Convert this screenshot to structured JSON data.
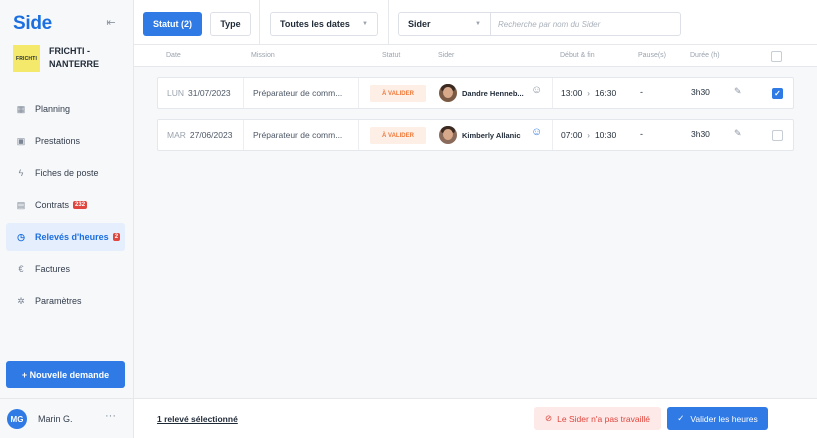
{
  "sidebar": {
    "brand": "Side",
    "collapse_icon": "collapse-sidebar-icon",
    "org": {
      "logo_text": "FRICHTI",
      "name": "FRICHTI - NANTERRE"
    },
    "items": [
      {
        "label": "Planning",
        "icon": "calendar-icon",
        "badge": ""
      },
      {
        "label": "Prestations",
        "icon": "briefcase-icon",
        "badge": ""
      },
      {
        "label": "Fiches de poste",
        "icon": "bolt-icon",
        "badge": ""
      },
      {
        "label": "Contrats",
        "icon": "document-icon",
        "badge": "232"
      },
      {
        "label": "Relevés d'heures",
        "icon": "clock-icon",
        "badge": "2"
      },
      {
        "label": "Factures",
        "icon": "euro-icon",
        "badge": ""
      },
      {
        "label": "Paramètres",
        "icon": "gear-icon",
        "badge": ""
      }
    ],
    "new_request": "+ Nouvelle demande",
    "user": {
      "initials": "MG",
      "name": "Marin G.",
      "more": "···"
    }
  },
  "toolbar": {
    "status_filter": "Statut (2)",
    "type_filter": "Type",
    "dates_filter": "Toutes les dates",
    "sider_select": "Sider",
    "search_placeholder": "Recherche par nom du Sider"
  },
  "table": {
    "headers": [
      "Date",
      "Mission",
      "Statut",
      "Sider",
      "Début & fin",
      "Pause(s)",
      "Durée (h)"
    ],
    "rows": [
      {
        "day": "LUN",
        "date": "31/07/2023",
        "mission": "Préparateur de comm...",
        "status": "À VALIDER",
        "sider": "Dandre Henneb...",
        "sider_icon": "smile-plus-icon",
        "start": "13:00",
        "end": "16:30",
        "pause": "-",
        "duration": "3h30",
        "checked": true
      },
      {
        "day": "MAR",
        "date": "27/06/2023",
        "mission": "Préparateur de comm...",
        "status": "À VALIDER",
        "sider": "Kimberly Allanic",
        "sider_icon": "smile-icon",
        "start": "07:00",
        "end": "10:30",
        "pause": "-",
        "duration": "3h30",
        "checked": false
      }
    ]
  },
  "footer": {
    "selected": "1 relevé sélectionné",
    "not_worked": "Le Sider n'a pas travaillé",
    "validate": "Valider les heures"
  },
  "colors": {
    "accent": "#2f7ae5",
    "status_text": "#f07a3c",
    "status_bg": "#fdeee6",
    "danger": "#e0463d"
  }
}
